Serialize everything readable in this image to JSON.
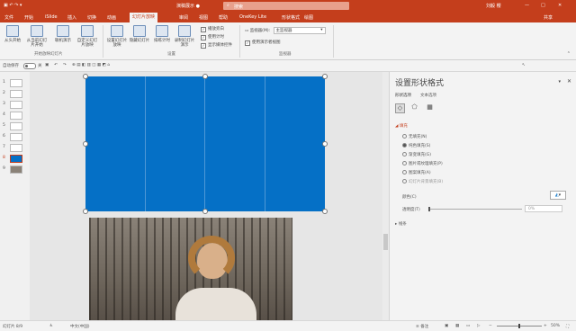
{
  "titlebar": {
    "doc_title": "演稿展示 ●",
    "search_placeholder": "搜索",
    "user": "刘毅 樱",
    "win_controls": [
      "—",
      "□",
      "✕"
    ]
  },
  "menubar": {
    "items": [
      "文件",
      "开始",
      "iSlide",
      "插入",
      "切换",
      "动画",
      "幻灯片放映",
      "审阅",
      "视图",
      "帮助",
      "OneKey Lite",
      "形状格式",
      "绘图"
    ],
    "active_index": 6,
    "share": "共享"
  },
  "ribbon": {
    "buttons": [
      {
        "label": "从头开始"
      },
      {
        "label": "从当前幻灯片开始"
      },
      {
        "label": "联机演示"
      },
      {
        "label": "自定义幻灯片放映"
      },
      {
        "label": "设置幻灯片放映"
      },
      {
        "label": "隐藏幻灯片"
      },
      {
        "label": "排练计时"
      },
      {
        "label": "录制幻灯片演示"
      }
    ],
    "checkboxes": [
      "播放旁白",
      "使用计时",
      "显示媒体控件"
    ],
    "monitor_label": "监视器(M):",
    "monitor_value": "主监视器",
    "presenter_view": "使用演示者视图",
    "groups": [
      "开始放映幻灯片",
      "设置",
      "监视器"
    ]
  },
  "qat": {
    "autosave": "自动保存",
    "toggle": "关"
  },
  "thumbnails": [
    "1",
    "2",
    "3",
    "4",
    "5",
    "6",
    "7",
    "8",
    "9"
  ],
  "active_slide": 8,
  "format_pane": {
    "title": "设置形状格式",
    "tabs": [
      "形状选项",
      "文本选项"
    ],
    "section_fill": "填充",
    "fill_options": [
      "无填充(N)",
      "纯色填充(S)",
      "渐变填充(G)",
      "图片或纹理填充(P)",
      "图案填充(A)",
      "幻灯片背景填充(B)"
    ],
    "selected_fill": 1,
    "color_label": "颜色(C)",
    "transparency_label": "透明度(T)",
    "transparency_value": "0%",
    "section_line": "线条",
    "close": "✕"
  },
  "status": {
    "slide_info": "幻灯片 8/9",
    "lang": "中文(中国)",
    "notes": "备注",
    "zoom": "50%"
  }
}
